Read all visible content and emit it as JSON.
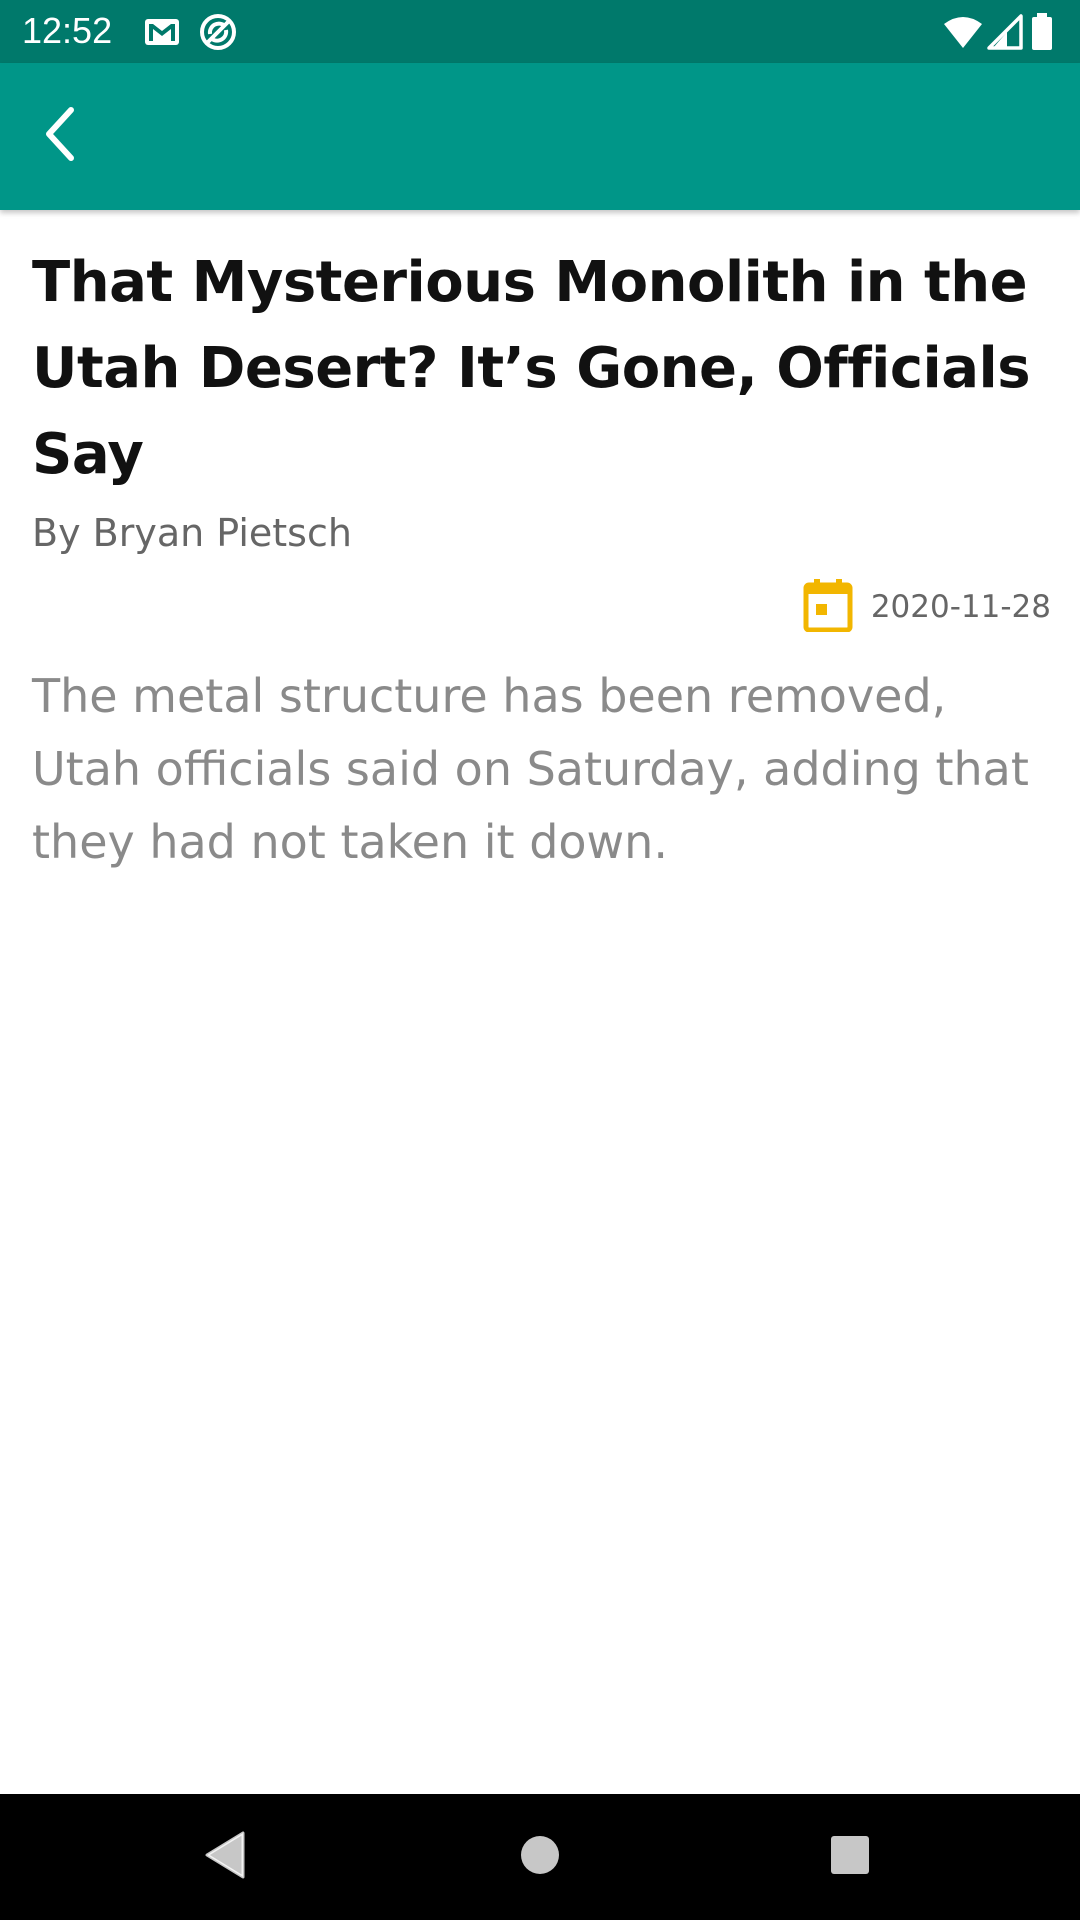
{
  "status_bar": {
    "time": "12:52",
    "left_icons": [
      "gmail-icon",
      "sync-icon"
    ],
    "right_icons": [
      "wifi-icon",
      "signal-icon",
      "battery-icon"
    ]
  },
  "app_bar": {
    "back_icon": "chevron-left-icon",
    "color": "#009688"
  },
  "article": {
    "title": "That Mysterious Monolith in the Utah Desert? It’s Gone, Officials Say",
    "byline": "By Bryan Pietsch",
    "date_icon": "calendar-icon",
    "date": "2020-11-28",
    "summary": "The metal structure has been removed, Utah officials said on Saturday, adding that they had not taken it down."
  },
  "colors": {
    "status_bar": "#00796b",
    "app_bar": "#009688",
    "calendar_accent": "#f2b600",
    "title_text": "#111111",
    "meta_text": "#666666",
    "summary_text": "#8a8a8a"
  },
  "nav_bar": {
    "icons": [
      "back-triangle-icon",
      "home-circle-icon",
      "recents-square-icon"
    ]
  }
}
